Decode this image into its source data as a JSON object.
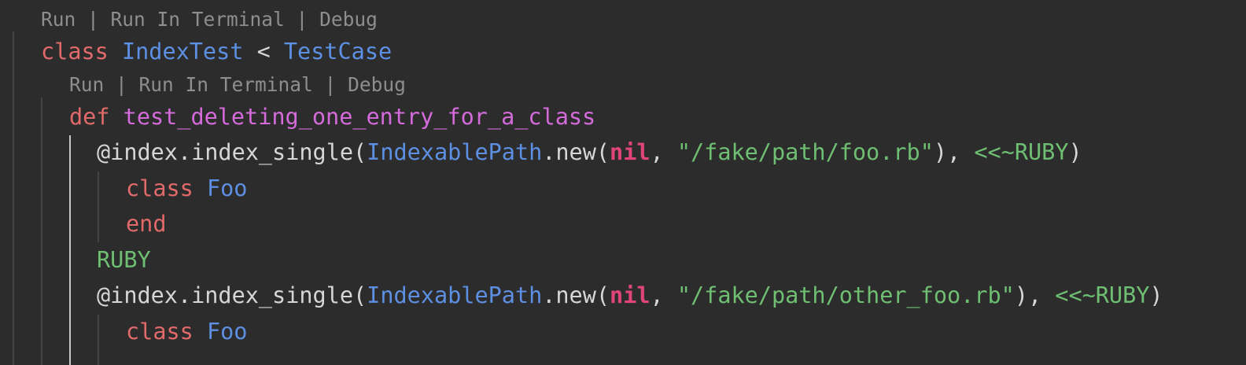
{
  "colors": {
    "background": "#2c2c2c",
    "keyword": "#e26a6a",
    "type": "#5d8fe3",
    "method_name": "#d56bdb",
    "nil": "#e0457a",
    "string": "#6fbf73",
    "plain": "#d6d6d6",
    "codelens": "#8e8e8e"
  },
  "codelens": {
    "run": "Run",
    "run_in_terminal": "Run In Terminal",
    "debug": "Debug",
    "separator": " | "
  },
  "code": {
    "l1": {
      "kw": "class",
      "sp1": " ",
      "name": "IndexTest",
      "op": " < ",
      "parent": "TestCase"
    },
    "l2": {
      "kw": "def",
      "sp1": " ",
      "name": "test_deleting_one_entry_for_a_class"
    },
    "l3": {
      "recv": "@index.index_single(",
      "cls": "IndexablePath",
      "call": ".new(",
      "nil": "nil",
      "comma": ", ",
      "path": "\"/fake/path/foo.rb\"",
      "close": "), ",
      "heredoc": "<<~RUBY",
      "paren": ")"
    },
    "l4": {
      "kw": "class",
      "sp1": " ",
      "name": "Foo"
    },
    "l5": {
      "kw": "end"
    },
    "l6": {
      "text": "RUBY"
    },
    "l7": {
      "recv": "@index.index_single(",
      "cls": "IndexablePath",
      "call": ".new(",
      "nil": "nil",
      "comma": ", ",
      "path": "\"/fake/path/other_foo.rb\"",
      "close": "), ",
      "heredoc": "<<~RUBY",
      "paren": ")"
    },
    "l8": {
      "kw": "class",
      "sp1": " ",
      "name": "Foo"
    }
  }
}
